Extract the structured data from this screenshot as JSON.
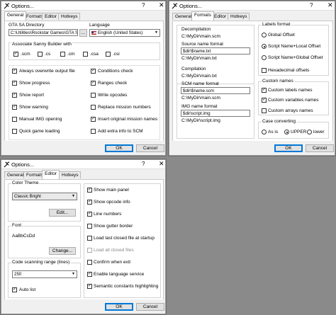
{
  "common": {
    "title": "Options...",
    "help_glyph": "?",
    "close_glyph": "✕",
    "tabs": [
      "General",
      "Formats",
      "Editor",
      "Hotkeys"
    ],
    "ok_label": "OK",
    "cancel_label": "Cancel",
    "check_mark": "✓"
  },
  "general": {
    "gta_dir_label": "GTA SA Directory",
    "gta_dir_value": "C:\\Utilities\\Rockstar Games\\GTA S...",
    "browse_label": "...",
    "language_label": "Language",
    "language_value": "English (United States)",
    "associate_title": "Associate Sanny Builder with",
    "ext": [
      ".scm",
      ".cs",
      ".cm",
      ".csa",
      ".csi"
    ],
    "left_options": [
      "Always overwrite output file",
      "Show progress",
      "Show report",
      "Show warning",
      "Manual IMG opening",
      "Quick game loading"
    ],
    "right_options": [
      "Conditions check",
      "Ranges check",
      "Write opcodes",
      "Replace mission numbers",
      "Insert original mission names",
      "Add extra info to SCM"
    ]
  },
  "formats": {
    "decompilation_label": "Decompilation",
    "decompilation_value": "C:\\MyDir\\main.scm",
    "source_name_format_label": "Source name format",
    "source_name_format_value": "$dir\\$name.txt",
    "source_name_preview": "C:\\MyDir\\main.txt",
    "compilation_label": "Compilation",
    "compilation_value": "C:\\MyDir\\main.txt",
    "scm_name_format_label": "SCM name format",
    "scm_name_format_value": "$dir\\$name.scm",
    "scm_name_preview": "C:\\MyDir\\main.scm",
    "img_name_format_label": "IMG name format",
    "img_name_format_value": "$dir\\script.img",
    "img_name_preview": "C:\\MyDir\\script.img",
    "labels_format_title": "Labels format",
    "labels_options": [
      "Global Offset",
      "Script Name+Local Offset",
      "Script Name+Global Offset"
    ],
    "hex_offsets": "Hexadecimal offsets",
    "custom_names_title": "Custom names",
    "custom_names": [
      "Custom labels names",
      "Custom variables names",
      "Custom arrays names"
    ],
    "case_title": "Case converting",
    "case_options": [
      "As is",
      "UPPER",
      "lower"
    ]
  },
  "editor": {
    "color_theme_title": "Color Theme",
    "color_theme_value": "Classic Bright",
    "edit_label": "Edit...",
    "font_title": "Font",
    "font_sample": "AaBbCcDd",
    "change_label": "Change...",
    "code_scan_title": "Code scanning range (lines)",
    "code_scan_value": "250",
    "auto_list": "Auto list",
    "options": [
      "Show main panel",
      "Show opcode info",
      "Line numbers",
      "Show gutter border",
      "Load last closed file at startup",
      "Load all closed files",
      "Confirm when exit",
      "Enable language service",
      "Semantic constants highlighting"
    ]
  }
}
